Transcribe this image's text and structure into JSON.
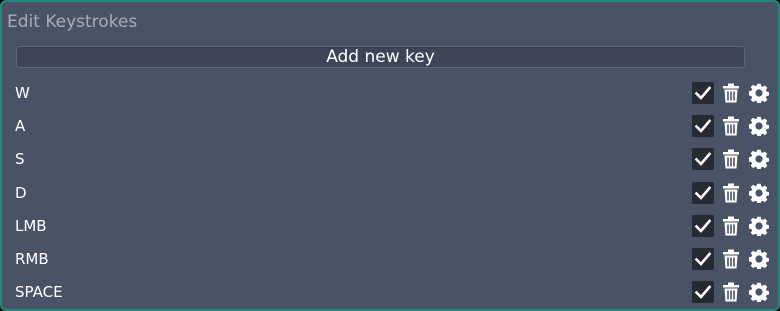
{
  "panel": {
    "title": "Edit Keystrokes",
    "add_button_label": "Add new key"
  },
  "keys": [
    {
      "label": "W",
      "enabled": true
    },
    {
      "label": "A",
      "enabled": true
    },
    {
      "label": "S",
      "enabled": true
    },
    {
      "label": "D",
      "enabled": true
    },
    {
      "label": "LMB",
      "enabled": true
    },
    {
      "label": "RMB",
      "enabled": true
    },
    {
      "label": "SPACE",
      "enabled": true
    }
  ],
  "icons": {
    "checkbox": "check-icon",
    "delete": "trash-icon",
    "settings": "gear-icon"
  },
  "colors": {
    "panel_bg": "#4a5366",
    "border_accent": "#1d8b7a",
    "button_bg": "#3c4455",
    "checkbox_bg": "#252a33",
    "title_text": "#a9adb6"
  }
}
